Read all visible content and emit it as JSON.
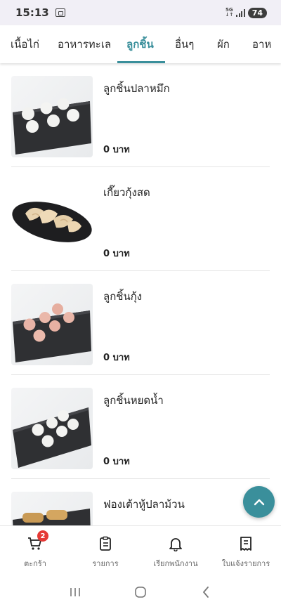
{
  "status_bar": {
    "time": "15:13",
    "network": "5G",
    "battery": "74"
  },
  "tabs": [
    {
      "label": "เนื้อไก่",
      "active": false
    },
    {
      "label": "อาหารทะเล",
      "active": false
    },
    {
      "label": "ลูกชิ้น",
      "active": true
    },
    {
      "label": "อื่นๆ",
      "active": false
    },
    {
      "label": "ผัก",
      "active": false
    },
    {
      "label": "อาห",
      "active": false
    }
  ],
  "items": [
    {
      "name": "ลูกชิ้นปลาหมึก",
      "price": "0 บาท",
      "image": "squid-balls-on-black-plate"
    },
    {
      "name": "เกี๊ยวกุ้งสด",
      "price": "0 บาท",
      "image": "shrimp-dumplings-on-black-plate"
    },
    {
      "name": "ลูกชิ้นกุ้ง",
      "price": "0 บาท",
      "image": "shrimp-balls-on-black-plate"
    },
    {
      "name": "ลูกชิ้นหยดน้ำ",
      "price": "0 บาท",
      "image": "water-drop-balls-on-black-plate"
    },
    {
      "name": "ฟองเต้าหู้ปลาม้วน",
      "price": "",
      "image": "fish-tofu-skin-rolls-on-black-plate"
    }
  ],
  "fab": {
    "icon": "chevron-up-icon"
  },
  "bottom_nav": [
    {
      "label": "ตะกร้า",
      "icon": "cart-icon",
      "badge": "2"
    },
    {
      "label": "รายการ",
      "icon": "clipboard-icon"
    },
    {
      "label": "เรียกพนักงาน",
      "icon": "bell-icon"
    },
    {
      "label": "ใบแจ้งรายการ",
      "icon": "receipt-icon"
    }
  ],
  "system_nav": {
    "recents": "recents-icon",
    "home": "home-icon",
    "back": "back-icon"
  },
  "colors": {
    "accent": "#3a8f9b",
    "badge": "#e53935"
  }
}
